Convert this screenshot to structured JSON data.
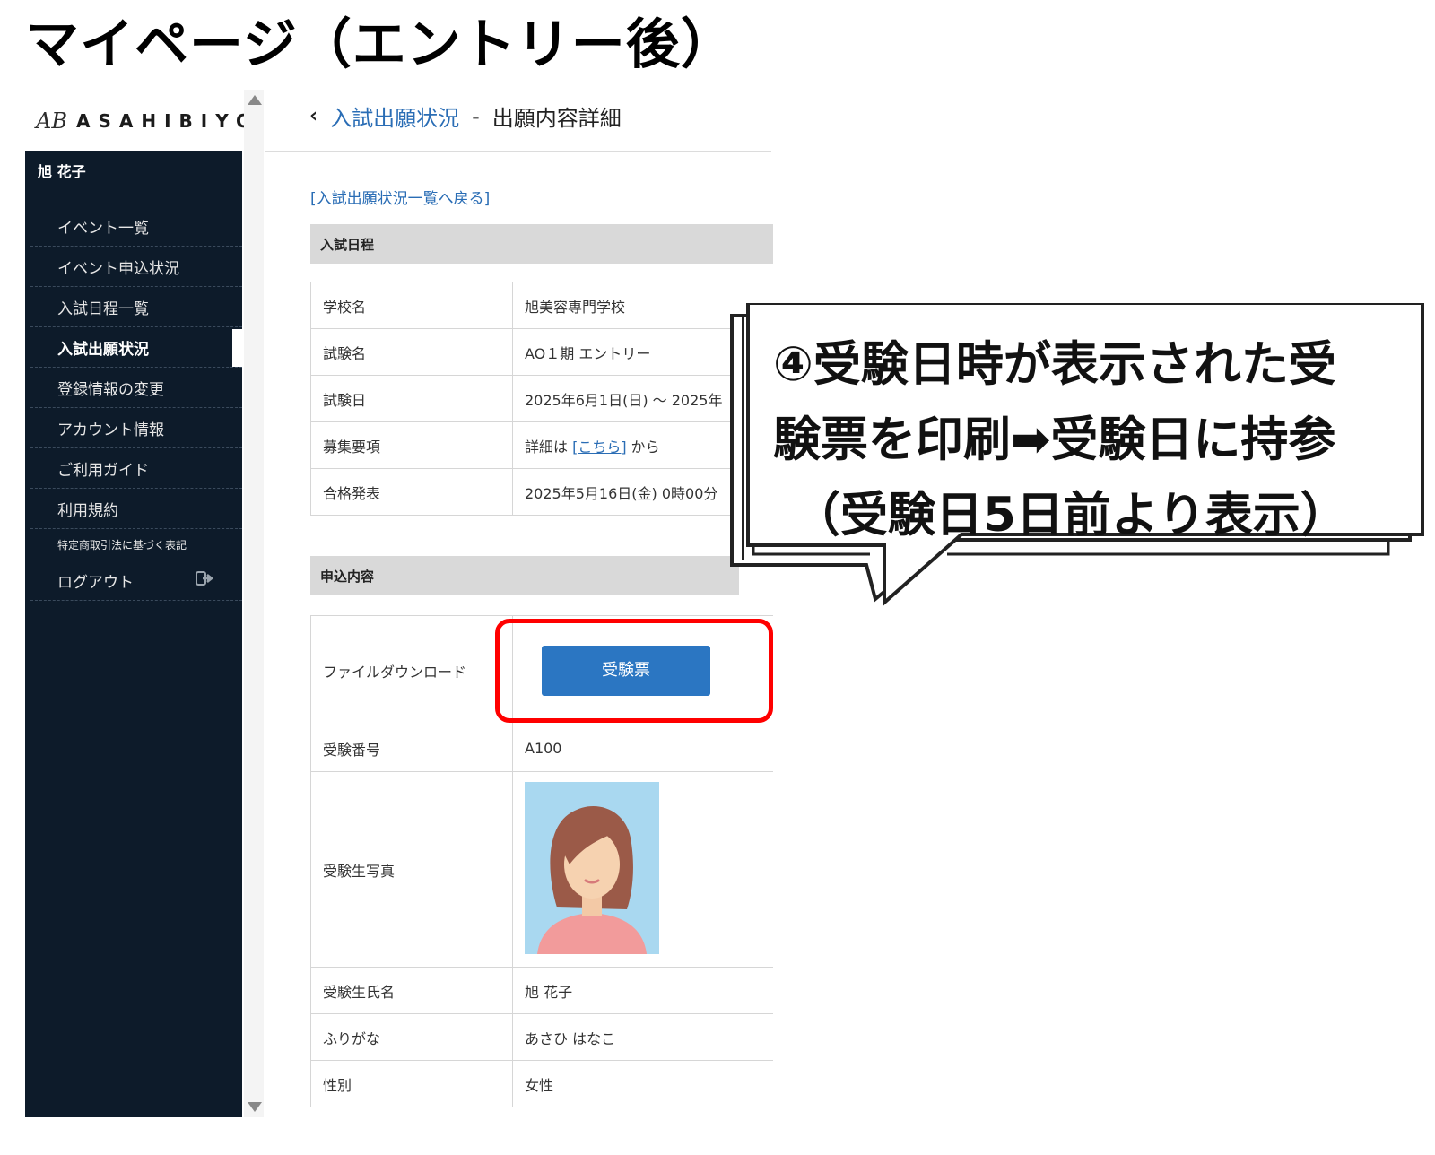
{
  "slide_title": "マイページ（エントリー後）",
  "logo": {
    "mark": "AB",
    "text": "ASAHIBIYO"
  },
  "sidebar": {
    "user_name": "旭 花子",
    "items": [
      {
        "label": "イベント一覧"
      },
      {
        "label": "イベント申込状況"
      },
      {
        "label": "入試日程一覧"
      },
      {
        "label": "入試出願状況",
        "active": true
      },
      {
        "label": "登録情報の変更"
      },
      {
        "label": "アカウント情報"
      },
      {
        "label": "ご利用ガイド"
      },
      {
        "label": "利用規約"
      },
      {
        "label": "特定商取引法に基づく表記"
      },
      {
        "label": "ログアウト",
        "icon": "logout-icon"
      }
    ]
  },
  "breadcrumb": {
    "back_icon": "chevron-left-icon",
    "parent": "入試出願状況",
    "separator": "-",
    "current": "出願内容詳細"
  },
  "back_link": "[入試出願状況一覧へ戻る]",
  "section_schedule": {
    "title": "入試日程",
    "rows": [
      {
        "label": "学校名",
        "value": "旭美容専門学校"
      },
      {
        "label": "試験名",
        "value": "AO１期 エントリー"
      },
      {
        "label": "試験日",
        "value": "2025年6月1日(日) ～ 2025年"
      },
      {
        "label": "募集要項",
        "value_prefix": "詳細は ",
        "value_link": "[こちら]",
        "value_suffix": " から"
      },
      {
        "label": "合格発表",
        "value": "2025年5月16日(金) 0時00分"
      }
    ]
  },
  "section_application": {
    "title": "申込内容",
    "rows": [
      {
        "label": "ファイルダウンロード",
        "button": "受験票"
      },
      {
        "label": "受験番号",
        "value": "A100"
      },
      {
        "label": "受験生写真",
        "photo": "applicant-photo"
      },
      {
        "label": "受験生氏名",
        "value": "旭 花子"
      },
      {
        "label": "ふりがな",
        "value": "あさひ はなこ"
      },
      {
        "label": "性別",
        "value": "女性"
      }
    ]
  },
  "callout": {
    "line1": "④受験日時が表示された受",
    "line2": "験票を印刷➡受験日に持参",
    "line3": "（受験日5日前より表示）"
  },
  "colors": {
    "sidebar_bg": "#0d1b2a",
    "link": "#2a6db5",
    "button": "#2b76c2",
    "highlight": "#ff0000",
    "section_header": "#d9d9d9"
  }
}
